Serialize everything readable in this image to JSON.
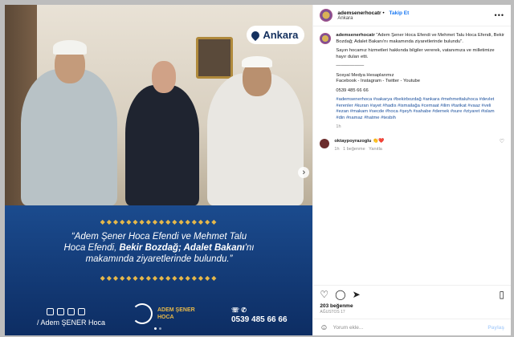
{
  "media": {
    "location": "Ankara",
    "quote_line1": "“Adem Şener Hoca Efendi ve Mehmet Talu",
    "quote_line2_pre": "Hoca Efendi, ",
    "quote_bold": "Bekir Bozdağ; Adalet Bakanı",
    "quote_line2_post": "'nı",
    "quote_line3": "makamında ziyaretlerinde bulundu.”",
    "footer_handle": "/ Adem ŞENER Hoca",
    "logo_line1": "ADEM ŞENER",
    "logo_line2": "HOCA",
    "phone": "0539 485 66 66"
  },
  "header": {
    "username": "ademsenerhocatr",
    "separator": "•",
    "follow": "Takip Et",
    "location": "Ankara"
  },
  "caption": {
    "username": "ademsenerhocatr",
    "text1": "\"Adem Şener Hoca Efendi ve Mehmet Talu Hoca Efendi, Bekir Bozdağ; Adalet Bakanı'nı makamında ziyaretlerinde bulundu\".",
    "text2": "Sayın hocamız hizmetleri hakkında bilgiler vererek, vatanımıza ve milletimize hayır duları etti.",
    "divider": "——————",
    "social_title": "Sosyal Medya Hesaplarımız",
    "social_list": "Facebook - Instagram - Twitter - Youtube",
    "phone": "0539 485 66 66",
    "hashtags": "#ademsenerhoca #sakarya #bekirbozdağ #ankara #mehmettaluhoca #devlet #erenler #kuran #ayet #hadis #ismailağa #cemaat #ilim #tarikat #vaaz #veli #ezan #makam #secde #hoca #şeyh #sahabe #dernek #sure #ziyaret #islam #din #namaz #hatme #tesbih",
    "time": "1h"
  },
  "comment": {
    "username": "oktaypoyrazoglu",
    "text": "👏❤️",
    "time": "1h",
    "likes": "1 beğenme",
    "reply": "Yanıtla"
  },
  "footer": {
    "likes": "203 beğenme",
    "date": "AĞUSTOS 17",
    "add_placeholder": "Yorum ekle...",
    "post": "Paylaş"
  }
}
